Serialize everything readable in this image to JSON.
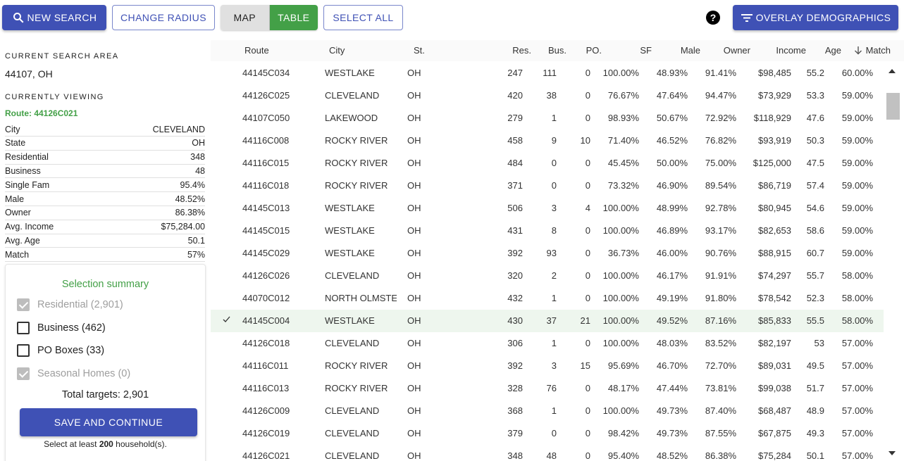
{
  "toolbar": {
    "new_search": "NEW SEARCH",
    "change_radius": "CHANGE RADIUS",
    "map": "MAP",
    "table": "TABLE",
    "select_all": "SELECT ALL",
    "help": "?",
    "overlay": "OVERLAY DEMOGRAPHICS"
  },
  "left": {
    "search_area_label": "CURRENT SEARCH AREA",
    "search_area": "44107, OH",
    "viewing_label": "CURRENTLY VIEWING",
    "route": "Route: 44126C021",
    "details": [
      {
        "k": "City",
        "v": "CLEVELAND"
      },
      {
        "k": "State",
        "v": "OH"
      },
      {
        "k": "Residential",
        "v": "348"
      },
      {
        "k": "Business",
        "v": "48"
      },
      {
        "k": "Single Fam",
        "v": "95.4%"
      },
      {
        "k": "Male",
        "v": "48.52%"
      },
      {
        "k": "Owner",
        "v": "86.38%"
      },
      {
        "k": "Avg. Income",
        "v": "$75,284.00"
      },
      {
        "k": "Avg. Age",
        "v": "50.1"
      },
      {
        "k": "Match",
        "v": "57%"
      }
    ]
  },
  "summary": {
    "title": "Selection summary",
    "options": [
      {
        "label": "Residential (2,901)",
        "checked": true,
        "disabled": true
      },
      {
        "label": "Business (462)",
        "checked": false,
        "disabled": false
      },
      {
        "label": "PO Boxes (33)",
        "checked": false,
        "disabled": false
      },
      {
        "label": "Seasonal Homes (0)",
        "checked": true,
        "disabled": true
      }
    ],
    "total": "Total targets: 2,901",
    "save": "SAVE AND CONTINUE",
    "hint_pre": "Select at least ",
    "hint_num": "200",
    "hint_post": " household(s)."
  },
  "table": {
    "headers": [
      "Route",
      "City",
      "St.",
      "Res.",
      "Bus.",
      "PO.",
      "SF",
      "Male",
      "Owner",
      "Income",
      "Age",
      "Match"
    ],
    "sort_icon": "arrow-down-icon",
    "rows": [
      {
        "sel": false,
        "c": [
          "44145C034",
          "WESTLAKE",
          "OH",
          "247",
          "111",
          "0",
          "100.00%",
          "48.93%",
          "91.41%",
          "$98,485",
          "55.2",
          "60.00%"
        ]
      },
      {
        "sel": false,
        "c": [
          "44126C025",
          "CLEVELAND",
          "OH",
          "420",
          "38",
          "0",
          "76.67%",
          "47.64%",
          "94.47%",
          "$73,929",
          "53.3",
          "59.00%"
        ]
      },
      {
        "sel": false,
        "c": [
          "44107C050",
          "LAKEWOOD",
          "OH",
          "279",
          "1",
          "0",
          "98.93%",
          "50.67%",
          "72.92%",
          "$118,929",
          "47.6",
          "59.00%"
        ]
      },
      {
        "sel": false,
        "c": [
          "44116C008",
          "ROCKY RIVER",
          "OH",
          "458",
          "9",
          "10",
          "71.40%",
          "46.52%",
          "76.82%",
          "$93,919",
          "50.3",
          "59.00%"
        ]
      },
      {
        "sel": false,
        "c": [
          "44116C015",
          "ROCKY RIVER",
          "OH",
          "484",
          "0",
          "0",
          "45.45%",
          "50.00%",
          "75.00%",
          "$125,000",
          "47.5",
          "59.00%"
        ]
      },
      {
        "sel": false,
        "c": [
          "44116C018",
          "ROCKY RIVER",
          "OH",
          "371",
          "0",
          "0",
          "73.32%",
          "46.90%",
          "89.54%",
          "$86,719",
          "57.4",
          "59.00%"
        ]
      },
      {
        "sel": false,
        "c": [
          "44145C013",
          "WESTLAKE",
          "OH",
          "506",
          "3",
          "4",
          "100.00%",
          "48.99%",
          "92.78%",
          "$80,945",
          "54.6",
          "59.00%"
        ]
      },
      {
        "sel": false,
        "c": [
          "44145C015",
          "WESTLAKE",
          "OH",
          "431",
          "8",
          "0",
          "100.00%",
          "46.89%",
          "93.17%",
          "$82,653",
          "58.6",
          "59.00%"
        ]
      },
      {
        "sel": false,
        "c": [
          "44145C029",
          "WESTLAKE",
          "OH",
          "392",
          "93",
          "0",
          "36.73%",
          "46.00%",
          "90.76%",
          "$88,915",
          "60.7",
          "59.00%"
        ]
      },
      {
        "sel": false,
        "c": [
          "44126C026",
          "CLEVELAND",
          "OH",
          "320",
          "2",
          "0",
          "100.00%",
          "46.17%",
          "91.91%",
          "$74,297",
          "55.7",
          "58.00%"
        ]
      },
      {
        "sel": false,
        "c": [
          "44070C012",
          "NORTH OLMSTE",
          "OH",
          "432",
          "1",
          "0",
          "100.00%",
          "49.19%",
          "91.80%",
          "$78,542",
          "52.3",
          "58.00%"
        ]
      },
      {
        "sel": true,
        "c": [
          "44145C004",
          "WESTLAKE",
          "OH",
          "430",
          "37",
          "21",
          "100.00%",
          "49.52%",
          "87.16%",
          "$85,833",
          "55.5",
          "58.00%"
        ]
      },
      {
        "sel": false,
        "c": [
          "44126C018",
          "CLEVELAND",
          "OH",
          "306",
          "1",
          "0",
          "100.00%",
          "48.03%",
          "83.52%",
          "$82,197",
          "53",
          "57.00%"
        ]
      },
      {
        "sel": false,
        "c": [
          "44116C011",
          "ROCKY RIVER",
          "OH",
          "392",
          "3",
          "15",
          "95.69%",
          "46.70%",
          "72.70%",
          "$89,031",
          "49.5",
          "57.00%"
        ]
      },
      {
        "sel": false,
        "c": [
          "44116C013",
          "ROCKY RIVER",
          "OH",
          "328",
          "76",
          "0",
          "48.17%",
          "47.44%",
          "73.81%",
          "$99,038",
          "51.7",
          "57.00%"
        ]
      },
      {
        "sel": false,
        "c": [
          "44126C009",
          "CLEVELAND",
          "OH",
          "368",
          "1",
          "0",
          "100.00%",
          "49.73%",
          "87.40%",
          "$68,487",
          "48.9",
          "57.00%"
        ]
      },
      {
        "sel": false,
        "c": [
          "44126C019",
          "CLEVELAND",
          "OH",
          "379",
          "0",
          "0",
          "98.42%",
          "49.73%",
          "87.55%",
          "$67,875",
          "49.3",
          "57.00%"
        ]
      },
      {
        "sel": false,
        "c": [
          "44126C021",
          "CLEVELAND",
          "OH",
          "348",
          "48",
          "0",
          "95.40%",
          "48.52%",
          "86.38%",
          "$75,284",
          "50.1",
          "57.00%"
        ]
      }
    ]
  },
  "colors": {
    "primary": "#3f51b5",
    "green": "#43a047",
    "selected_row": "#eef6ee"
  }
}
